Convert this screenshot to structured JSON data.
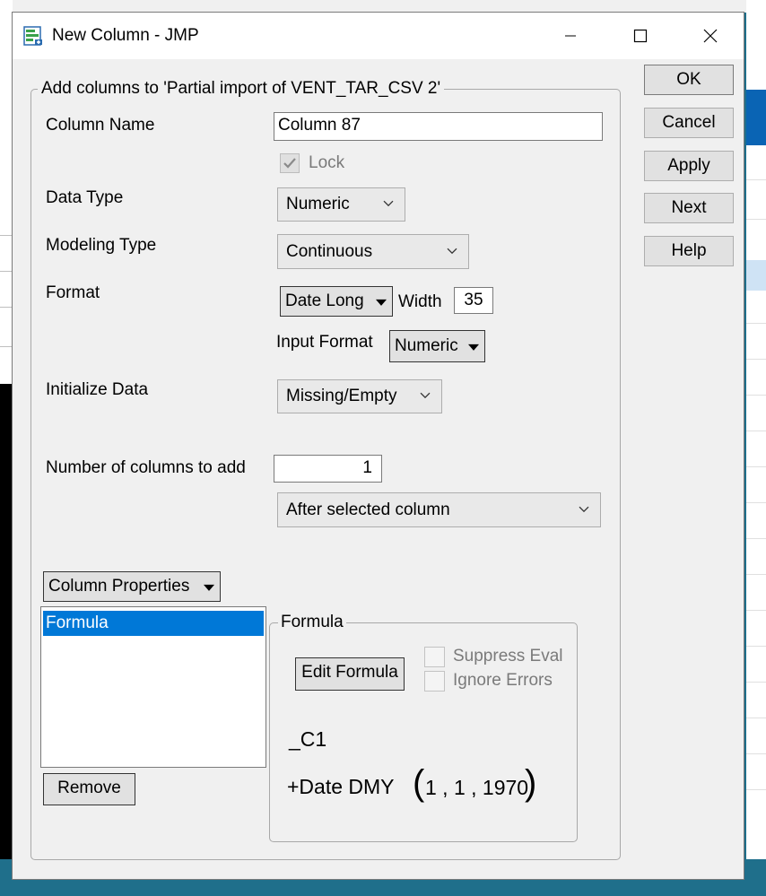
{
  "window": {
    "title": "New Column - JMP",
    "minimize_icon": "minimize-icon",
    "maximize_icon": "maximize-icon",
    "close_icon": "close-icon"
  },
  "group": {
    "legend": "Add columns to 'Partial import of VENT_TAR_CSV 2'"
  },
  "fields": {
    "column_name_label": "Column Name",
    "column_name_value": "Column 87",
    "lock_label": "Lock",
    "data_type_label": "Data Type",
    "data_type_value": "Numeric",
    "modeling_type_label": "Modeling Type",
    "modeling_type_value": "Continuous",
    "format_label": "Format",
    "format_value": "Date Long",
    "width_label": "Width",
    "width_value": "35",
    "input_format_label": "Input Format",
    "input_format_value": "Numeric",
    "initialize_label": "Initialize Data",
    "initialize_value": "Missing/Empty",
    "num_columns_label": "Number of columns to add",
    "num_columns_value": "1",
    "position_value": "After selected column"
  },
  "buttons": {
    "ok": "OK",
    "cancel": "Cancel",
    "apply": "Apply",
    "next": "Next",
    "help": "Help"
  },
  "properties": {
    "menu_label": "Column Properties",
    "list": [
      "Formula"
    ],
    "remove_label": "Remove"
  },
  "formula_panel": {
    "legend": "Formula",
    "edit_label": "Edit Formula",
    "suppress_eval_label": "Suppress Eval",
    "ignore_errors_label": "Ignore Errors",
    "line1": "_C1",
    "line2_prefix": "+Date DMY",
    "line2_args": "1 , 1 , 1970"
  },
  "colors": {
    "selection": "#0078d7",
    "dialog_bg": "#f0f0f0",
    "desktop": "#1f6f8b"
  }
}
